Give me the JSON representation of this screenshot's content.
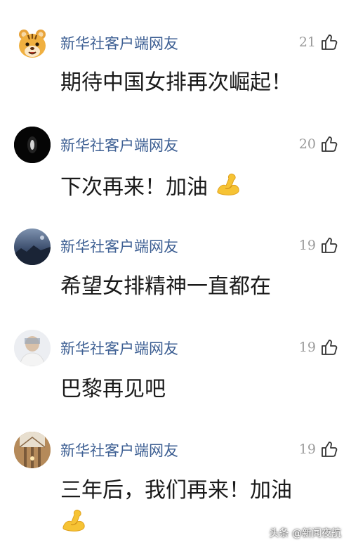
{
  "comments": [
    {
      "username": "新华社客户端网友",
      "likes": "21",
      "text": "期待中国女排再次崛起！",
      "emoji": ""
    },
    {
      "username": "新华社客户端网友",
      "likes": "20",
      "text": "下次再来！加油",
      "emoji": "flexed-biceps"
    },
    {
      "username": "新华社客户端网友",
      "likes": "19",
      "text": "希望女排精神一直都在",
      "emoji": ""
    },
    {
      "username": "新华社客户端网友",
      "likes": "19",
      "text": "巴黎再见吧",
      "emoji": ""
    },
    {
      "username": "新华社客户端网友",
      "likes": "19",
      "text": "三年后，我们再来！加油",
      "emoji": "flexed-biceps"
    }
  ],
  "watermark": "头条 @新闻夜航",
  "colors": {
    "username": "#3d5f93",
    "likes": "#9a9a9a",
    "text": "#1a1a1a"
  }
}
